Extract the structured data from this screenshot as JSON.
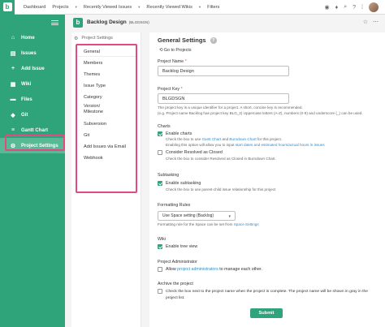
{
  "topbar": {
    "nav": [
      "Dashboard",
      "Projects",
      "Recently Viewed Issues",
      "Recently Viewed Wikis",
      "Filters"
    ]
  },
  "sidebar": {
    "items": [
      {
        "label": "Home",
        "icon": "home-icon",
        "glyph": "⌂"
      },
      {
        "label": "Issues",
        "icon": "issues-icon",
        "glyph": "▤"
      },
      {
        "label": "Add Issue",
        "icon": "plus-icon",
        "glyph": "+"
      },
      {
        "label": "Wiki",
        "icon": "wiki-icon",
        "glyph": "▦"
      },
      {
        "label": "Files",
        "icon": "folder-icon",
        "glyph": "▬"
      },
      {
        "label": "Git",
        "icon": "git-icon",
        "glyph": "◆"
      },
      {
        "label": "Gantt Chart",
        "icon": "gantt-icon",
        "glyph": "≡"
      },
      {
        "label": "Project Settings",
        "icon": "gear-icon",
        "glyph": "⚙"
      }
    ]
  },
  "project": {
    "logo": "b",
    "name": "Backlog Design",
    "key": "(BLGDSGN)"
  },
  "settings_nav": {
    "title": "Project Settings",
    "items": [
      "General",
      "Members",
      "Themes",
      "Issue Type",
      "Category",
      "Version/\nMilestone",
      "Subversion",
      "Git",
      "Add Issues via Email",
      "Webhook"
    ]
  },
  "main": {
    "title": "General Settings",
    "go_to_projects": "Go to Projects",
    "project_name_label": "Project Name",
    "project_name_value": "Backlog Design",
    "project_key_label": "Project Key",
    "project_key_value": "BLGDSGN",
    "project_key_hint1": "The project key is a unique identifier for a project. A short, concise key is recommended.",
    "project_key_hint2": "(e.g. Project name Backlog has project key BLG_2) Uppercase letters (A-Z), numbers (0-9) and underscore (_) can be used.",
    "charts_label": "Charts",
    "enable_charts": "Enable charts",
    "charts_hint_pre": "Check the box to use",
    "charts_hint_gantt": "Gantt Chart",
    "charts_hint_and": "and",
    "charts_hint_burndown": "Burndown Chart",
    "charts_hint_post": "for this project.",
    "charts_hint2_pre": "Enabling this option will allow you to input",
    "charts_hint2_link": "start dates and estimated hours/actual hours in issues",
    "consider_resolved": "Consider Resolved as Closed",
    "consider_hint": "Check the box to consider Resolved as Closed in Burndown Chart.",
    "subtasking_label": "Subtasking",
    "enable_subtasking": "Enable subtasking",
    "subtasking_hint": "Check the box to use parent-child issue relationship for this project",
    "formatting_label": "Formatting Rules",
    "formatting_value": "Use Space setting (Backlog)",
    "formatting_hint_pre": "Formatting rule for the Space can be set from",
    "formatting_hint_link": "Space Settings",
    "wiki_label": "Wiki",
    "enable_tree": "Enable tree view",
    "admin_label": "Project Administrator",
    "admin_text_pre": "Allow",
    "admin_text_link": "project administrators",
    "admin_text_post": "to manage each other.",
    "archive_label": "Archive the project",
    "archive_text1": "Check the box next to the project name when the project is complete. The project name will be shown in gray in the",
    "archive_text2": "project list.",
    "submit": "Submit"
  },
  "colors": {
    "brand": "#2fa37a",
    "highlight": "#e04b84",
    "link": "#2f8ec9"
  }
}
